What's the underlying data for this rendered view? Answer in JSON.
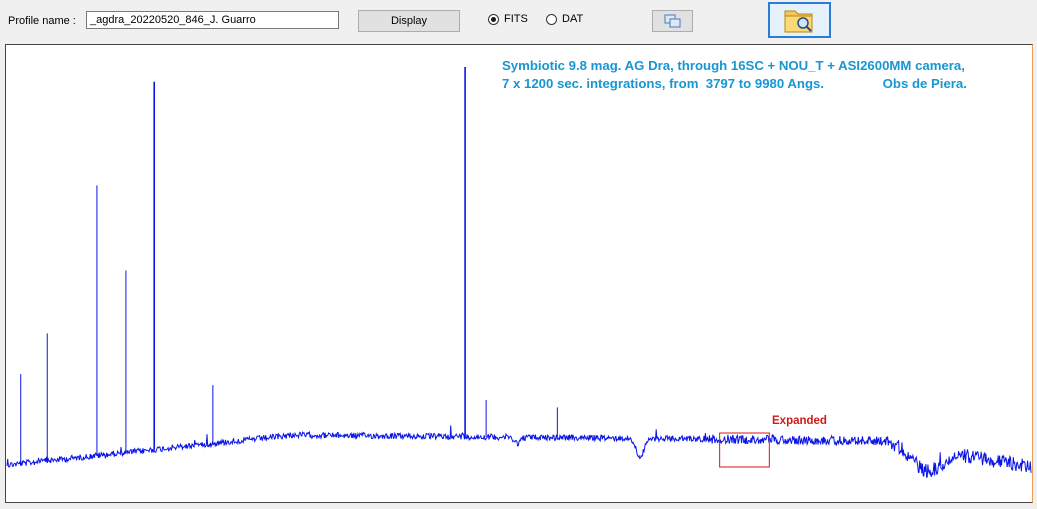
{
  "toolbar": {
    "profile_label": "Profile name :",
    "profile_value": "_agdra_20220520_846_J. Guarro",
    "display_label": "Display",
    "format_options": [
      {
        "label": "FITS",
        "selected": true
      },
      {
        "label": "DAT",
        "selected": false
      }
    ],
    "copy_icon": "copy-windows-icon",
    "open_icon": "folder-search-icon"
  },
  "plot": {
    "title_line1": "Symbiotic 9.8 mag. AG Dra, through 16SC + NOU_T + ASI2600MM camera,",
    "title_line2": "7 x 1200 sec. integrations, from  3797 to 9980 Angs.                Obs de Piera.",
    "expanded_label": "Expanded",
    "line_color": "#0a14e6",
    "marker_color": "#d11a1a",
    "title_color": "#1796d2"
  },
  "chart_data": {
    "type": "line",
    "x_range": [
      3797,
      9980
    ],
    "x_unit": "Angs.",
    "y_scale": "relative flux (unlabelled)",
    "axes_labels_visible": false,
    "emission_lines": [
      {
        "x": 3880,
        "y": 0.17
      },
      {
        "x": 4040,
        "y": 0.28
      },
      {
        "x": 4340,
        "y": 0.68
      },
      {
        "x": 4515,
        "y": 0.45
      },
      {
        "x": 4686,
        "y": 0.96
      },
      {
        "x": 5040,
        "y": 0.14
      },
      {
        "x": 6563,
        "y": 1.0
      },
      {
        "x": 6690,
        "y": 0.1
      },
      {
        "x": 7120,
        "y": 0.08
      }
    ],
    "expanded_region": [
      8100,
      8400
    ]
  }
}
